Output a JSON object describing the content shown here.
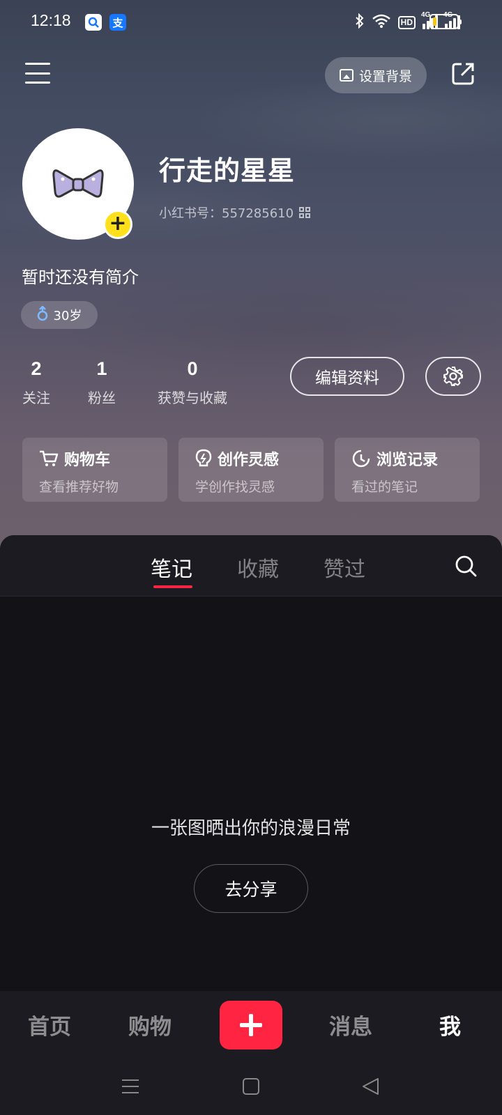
{
  "status_bar": {
    "time": "12:18",
    "search_badge": "Q",
    "pay_badge": "支",
    "hd": "HD",
    "net1": "4G",
    "net2": "4G",
    "battery_level": 0.15,
    "battery_color": "#f5c518"
  },
  "header": {
    "set_background_label": "设置背景"
  },
  "profile": {
    "username": "行走的星星",
    "id_label": "小红书号：557285610",
    "bio": "暂时还没有简介",
    "age": "30岁",
    "avatar_add": "+"
  },
  "stats": [
    {
      "number": "2",
      "label": "关注"
    },
    {
      "number": "1",
      "label": "粉丝"
    },
    {
      "number": "0",
      "label": "获赞与收藏"
    }
  ],
  "actions": {
    "edit_profile": "编辑资料"
  },
  "cards": [
    {
      "title": "购物车",
      "subtitle": "查看推荐好物",
      "icon": "cart-icon"
    },
    {
      "title": "创作灵感",
      "subtitle": "学创作找灵感",
      "icon": "lightbulb-icon"
    },
    {
      "title": "浏览记录",
      "subtitle": "看过的笔记",
      "icon": "clock-icon"
    }
  ],
  "tabs": [
    {
      "label": "笔记",
      "active": true
    },
    {
      "label": "收藏",
      "active": false
    },
    {
      "label": "赞过",
      "active": false
    }
  ],
  "empty_state": {
    "message": "一张图晒出你的浪漫日常",
    "button": "去分享"
  },
  "bottom_nav": [
    {
      "label": "首页",
      "active": false
    },
    {
      "label": "购物",
      "active": false
    },
    {
      "label": "消息",
      "active": false
    },
    {
      "label": "我",
      "active": true
    }
  ],
  "colors": {
    "accent": "#ff2442",
    "add_badge": "#ffe01b"
  }
}
